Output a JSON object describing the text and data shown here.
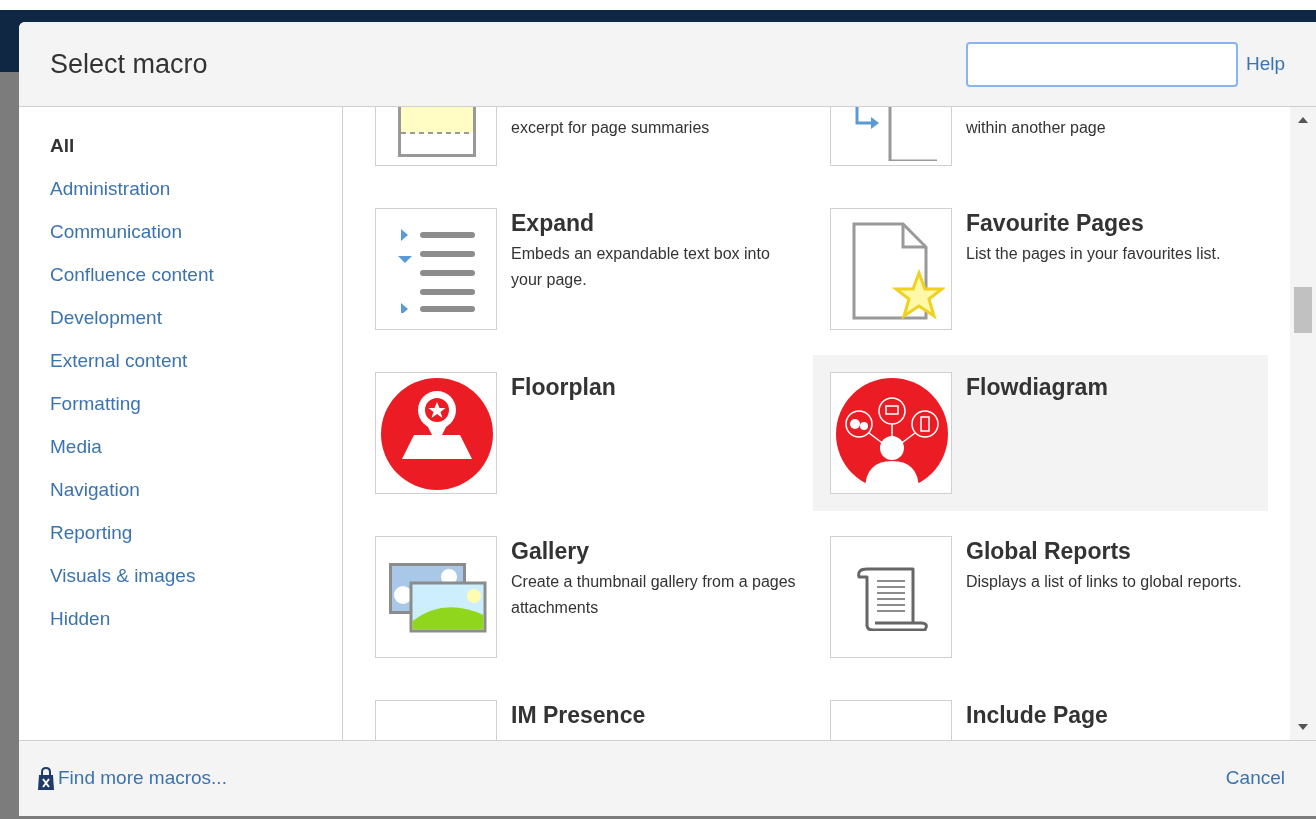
{
  "dialog": {
    "title": "Select macro",
    "help": "Help"
  },
  "categories": [
    {
      "label": "All",
      "selected": true
    },
    {
      "label": "Administration",
      "selected": false
    },
    {
      "label": "Communication",
      "selected": false
    },
    {
      "label": "Confluence content",
      "selected": false
    },
    {
      "label": "Development",
      "selected": false
    },
    {
      "label": "External content",
      "selected": false
    },
    {
      "label": "Formatting",
      "selected": false
    },
    {
      "label": "Media",
      "selected": false
    },
    {
      "label": "Navigation",
      "selected": false
    },
    {
      "label": "Reporting",
      "selected": false
    },
    {
      "label": "Visuals & images",
      "selected": false
    },
    {
      "label": "Hidden",
      "selected": false
    }
  ],
  "macros": [
    {
      "kind": "excerpt",
      "description": "excerpt for page summaries",
      "highlighted": false
    },
    {
      "kind": "include",
      "description": "within another page",
      "highlighted": false
    },
    {
      "kind": "expand",
      "title": "Expand",
      "description": "Embeds an expandable text box into your page.",
      "highlighted": false
    },
    {
      "kind": "favourite",
      "title": "Favourite Pages",
      "description": "List the pages in your favourites list.",
      "highlighted": false
    },
    {
      "kind": "floorplan",
      "title": "Floorplan",
      "highlighted": false
    },
    {
      "kind": "flowdiagram",
      "title": "Flowdiagram",
      "highlighted": true
    },
    {
      "kind": "gallery",
      "title": "Gallery",
      "description": "Create a thumbnail gallery from a pages attachments",
      "highlighted": false
    },
    {
      "kind": "reports",
      "title": "Global Reports",
      "description": "Displays a list of links to global reports.",
      "highlighted": false
    },
    {
      "kind": "blank",
      "title": "IM Presence",
      "highlighted": false
    },
    {
      "kind": "blank",
      "title": "Include Page",
      "highlighted": false
    }
  ],
  "footer": {
    "find_more": "Find more macros...",
    "cancel": "Cancel"
  }
}
